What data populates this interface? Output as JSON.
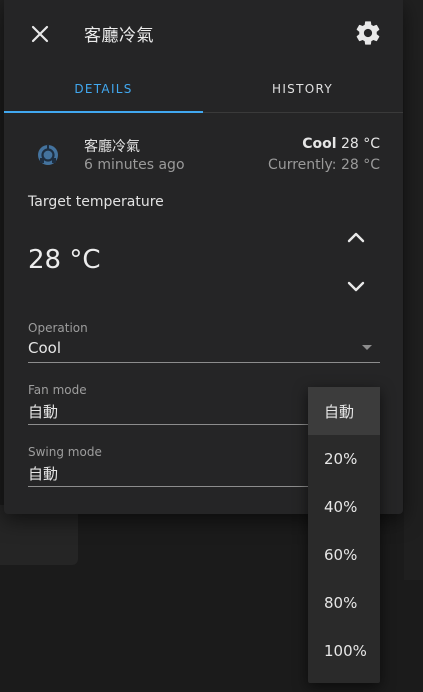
{
  "dialog": {
    "title": "客廳冷氣"
  },
  "tabs": [
    {
      "label": "DETAILS",
      "active": true
    },
    {
      "label": "HISTORY",
      "active": false
    }
  ],
  "entity": {
    "name": "客廳冷氣",
    "last_changed": "6 minutes ago",
    "state_mode": "Cool",
    "state_temp": "28 °C",
    "current": "Currently: 28 °C"
  },
  "target": {
    "label": "Target temperature",
    "value": "28 °C"
  },
  "operation": {
    "label": "Operation",
    "value": "Cool"
  },
  "fan_mode": {
    "label": "Fan mode",
    "value": "自動"
  },
  "swing_mode": {
    "label": "Swing mode",
    "value": "自動"
  },
  "fan_options": [
    {
      "label": "自動",
      "selected": true
    },
    {
      "label": "20%",
      "selected": false
    },
    {
      "label": "40%",
      "selected": false
    },
    {
      "label": "60%",
      "selected": false
    },
    {
      "label": "80%",
      "selected": false
    },
    {
      "label": "100%",
      "selected": false
    }
  ],
  "colors": {
    "accent": "#41a8f0",
    "dialog_bg": "#252526",
    "page_bg": "#1b1b1b"
  },
  "icons": {
    "close": "close-icon",
    "settings": "gear-icon",
    "entity": "thermostat-icon",
    "up": "chevron-up-icon",
    "down": "chevron-down-icon"
  }
}
